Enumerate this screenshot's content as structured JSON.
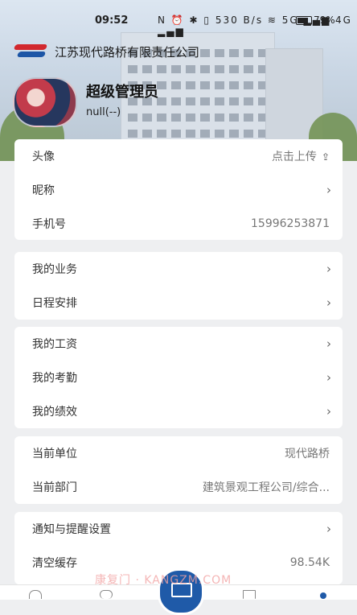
{
  "status_bar": {
    "time": "09:52",
    "icons": "N ⏰ ✱ ▯ 530 B/s ≋ 5G ▂▄▆ 4G ▂▄▆",
    "battery": "79%"
  },
  "header": {
    "company_name": "江苏现代路桥有限责任公司",
    "user_name": "超级管理员",
    "user_sub": "null(--)"
  },
  "groups": {
    "profile": [
      {
        "label": "头像",
        "value": "点击上传"
      },
      {
        "label": "昵称",
        "value": ""
      },
      {
        "label": "手机号",
        "value": "15996253871"
      }
    ],
    "business": [
      {
        "label": "我的业务"
      },
      {
        "label": "日程安排"
      }
    ],
    "hr": [
      {
        "label": "我的工资"
      },
      {
        "label": "我的考勤"
      },
      {
        "label": "我的绩效"
      }
    ],
    "org": [
      {
        "label": "当前单位",
        "value": "现代路桥"
      },
      {
        "label": "当前部门",
        "value": "建筑景观工程公司/综合..."
      }
    ],
    "settings": [
      {
        "label": "通知与提醒设置"
      },
      {
        "label": "清空缓存",
        "value": "98.54K"
      }
    ]
  },
  "watermark": "康复门 · KANGZM.COM",
  "icons": {
    "chevron": "›",
    "upload": "⇪"
  },
  "colors": {
    "brand_blue": "#1f5aa8",
    "brand_red": "#d2282e",
    "background": "#eeeff1"
  }
}
